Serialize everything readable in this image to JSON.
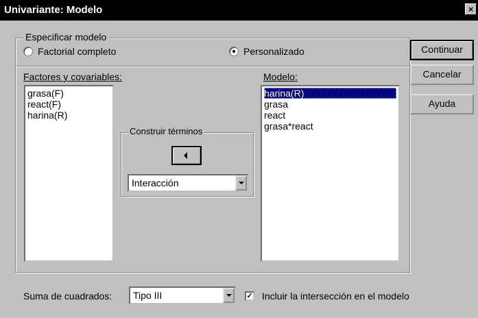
{
  "window": {
    "title": "Univariante: Modelo",
    "close_label": "×"
  },
  "specify_model": {
    "legend": "Especificar modelo",
    "options": [
      {
        "label": "Factorial completo",
        "selected": false
      },
      {
        "label": "Personalizado",
        "selected": true
      }
    ]
  },
  "factors": {
    "label": "Factores y covariables:",
    "items": [
      "grasa(F)",
      "react(F)",
      "harina(R)"
    ]
  },
  "build_terms": {
    "legend": "Construir términos",
    "arrow_icon": "left-arrow-icon",
    "type_value": "Interacción"
  },
  "model": {
    "label": "Modelo:",
    "items": [
      "harina(R)",
      "grasa",
      "react",
      "grasa*react"
    ],
    "selected_index": 0
  },
  "buttons": {
    "continue": "Continuar",
    "cancel": "Cancelar",
    "help": "Ayuda"
  },
  "sum_of_squares": {
    "label": "Suma de cuadrados:",
    "value": "Tipo III"
  },
  "include_intercept": {
    "label": "Incluir la intersección en el modelo",
    "checked": true
  }
}
